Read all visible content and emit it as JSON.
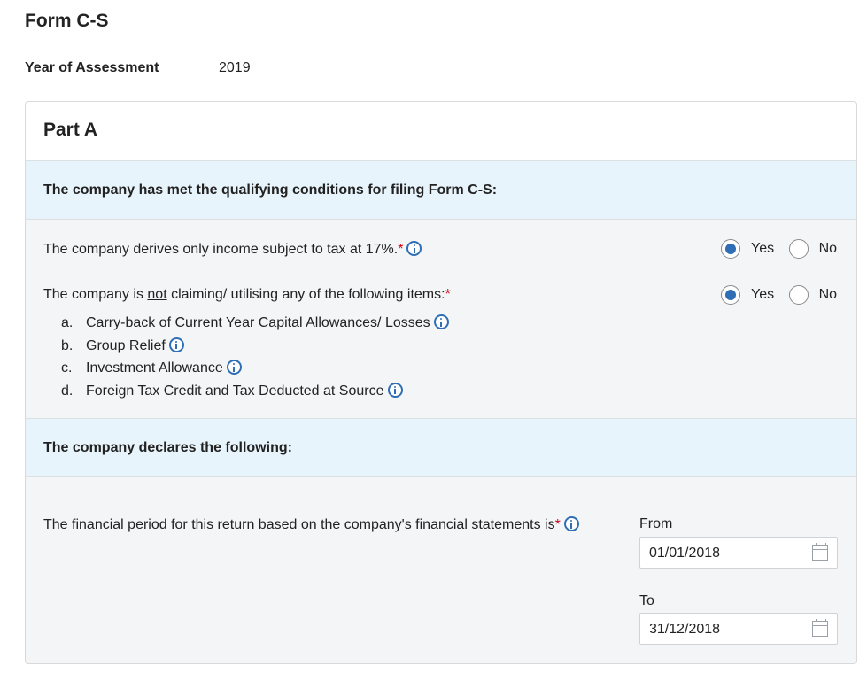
{
  "page": {
    "title": "Form C-S"
  },
  "assessment": {
    "label": "Year of Assessment",
    "value": "2019"
  },
  "part": {
    "title": "Part A"
  },
  "qualifying": {
    "header": "The company has met the qualifying conditions for filing Form C-S:",
    "q1": {
      "text": "The company derives only income subject to tax at 17%.",
      "required": "*",
      "selected": "Yes"
    },
    "q2": {
      "text_before": "The company is ",
      "text_underlined": "not",
      "text_after": " claiming/ utilising any of the following items:",
      "required": "*",
      "selected": "Yes",
      "items": [
        {
          "letter": "a.",
          "label": "Carry-back of Current Year Capital Allowances/ Losses"
        },
        {
          "letter": "b.",
          "label": "Group Relief"
        },
        {
          "letter": "c.",
          "label": "Investment Allowance"
        },
        {
          "letter": "d.",
          "label": "Foreign Tax Credit and Tax Deducted at Source"
        }
      ]
    },
    "yes_label": "Yes",
    "no_label": "No"
  },
  "declaration": {
    "header": "The company declares the following:",
    "period_text": "The financial period for this return based on the company's financial statements is",
    "required": "*",
    "from_label": "From",
    "from_value": "01/01/2018",
    "to_label": "To",
    "to_value": "31/12/2018"
  },
  "icons": {
    "info": "info-icon",
    "calendar": "calendar-icon"
  },
  "colors": {
    "accent": "#2f6eb5",
    "band": "#e8f4fc",
    "required": "#d0021b"
  }
}
